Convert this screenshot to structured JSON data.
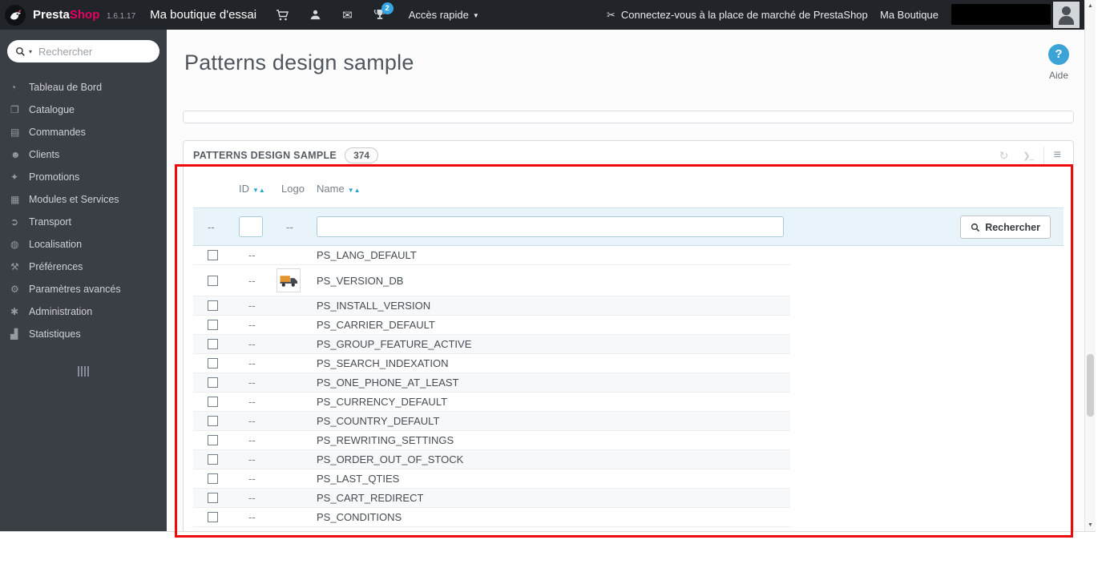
{
  "colors": {
    "brand_pink": "#e50064",
    "topbar_bg": "#212429",
    "sidebar_bg": "#3a3f46",
    "notification_badge_blue": "#35a6e5",
    "help_blue": "#3ba3d6",
    "sort_arrow_teal": "#2aa6cb",
    "filter_band_bg": "#e9f4fa",
    "annotation_red": "#ee0b0b"
  },
  "icons": {
    "sort_desc": "▼",
    "sort_asc": "▲",
    "caret_down": "▼",
    "search_caret": "▾",
    "envelope": "✉",
    "scissors": "✂",
    "refresh": "↻",
    "console": "❯_",
    "database": "≡",
    "scroll_up": "▲",
    "scroll_down": "▼"
  },
  "topbar": {
    "brand_presta": "Presta",
    "brand_shop": "Shop",
    "version": "1.6.1.17",
    "shop_name": "Ma boutique d'essai",
    "notification_count": "2",
    "quick_access_label": "Accès rapide",
    "marketplace_text": "Connectez-vous à la place de marché de PrestaShop",
    "my_shop_label": "Ma Boutique"
  },
  "sidebar": {
    "search_placeholder": "Rechercher",
    "items": [
      {
        "key": "tableau-de-bord",
        "label": "Tableau de Bord",
        "glyph": "◔"
      },
      {
        "key": "catalogue",
        "label": "Catalogue",
        "glyph": "❒"
      },
      {
        "key": "commandes",
        "label": "Commandes",
        "glyph": "▤"
      },
      {
        "key": "clients",
        "label": "Clients",
        "glyph": "☻"
      },
      {
        "key": "promotions",
        "label": "Promotions",
        "glyph": "✦"
      },
      {
        "key": "modules-et-services",
        "label": "Modules et Services",
        "glyph": "▦"
      },
      {
        "key": "transport",
        "label": "Transport",
        "glyph": "➲"
      },
      {
        "key": "localisation",
        "label": "Localisation",
        "glyph": "◍"
      },
      {
        "key": "preferences",
        "label": "Préférences",
        "glyph": "⚒"
      },
      {
        "key": "parametres-avances",
        "label": "Paramètres avancés",
        "glyph": "⚙"
      },
      {
        "key": "administration",
        "label": "Administration",
        "glyph": "✱"
      },
      {
        "key": "statistiques",
        "label": "Statistiques",
        "glyph": "▟"
      }
    ]
  },
  "page": {
    "title": "Patterns design sample",
    "help_label": "Aide",
    "help_glyph": "?"
  },
  "panel": {
    "title": "PATTERNS DESIGN SAMPLE",
    "count_badge": "374"
  },
  "table": {
    "columns": {
      "id": "ID",
      "logo": "Logo",
      "name": "Name"
    },
    "filter": {
      "checkbox_col_placeholder": "--",
      "logo_col_placeholder": "--",
      "search_button_label": "Rechercher"
    },
    "rows": [
      {
        "id": "--",
        "has_logo": false,
        "name": "PS_LANG_DEFAULT"
      },
      {
        "id": "--",
        "has_logo": true,
        "name": "PS_VERSION_DB"
      },
      {
        "id": "--",
        "has_logo": false,
        "name": "PS_INSTALL_VERSION"
      },
      {
        "id": "--",
        "has_logo": false,
        "name": "PS_CARRIER_DEFAULT"
      },
      {
        "id": "--",
        "has_logo": false,
        "name": "PS_GROUP_FEATURE_ACTIVE"
      },
      {
        "id": "--",
        "has_logo": false,
        "name": "PS_SEARCH_INDEXATION"
      },
      {
        "id": "--",
        "has_logo": false,
        "name": "PS_ONE_PHONE_AT_LEAST"
      },
      {
        "id": "--",
        "has_logo": false,
        "name": "PS_CURRENCY_DEFAULT"
      },
      {
        "id": "--",
        "has_logo": false,
        "name": "PS_COUNTRY_DEFAULT"
      },
      {
        "id": "--",
        "has_logo": false,
        "name": "PS_REWRITING_SETTINGS"
      },
      {
        "id": "--",
        "has_logo": false,
        "name": "PS_ORDER_OUT_OF_STOCK"
      },
      {
        "id": "--",
        "has_logo": false,
        "name": "PS_LAST_QTIES"
      },
      {
        "id": "--",
        "has_logo": false,
        "name": "PS_CART_REDIRECT"
      },
      {
        "id": "--",
        "has_logo": false,
        "name": "PS_CONDITIONS"
      }
    ]
  }
}
